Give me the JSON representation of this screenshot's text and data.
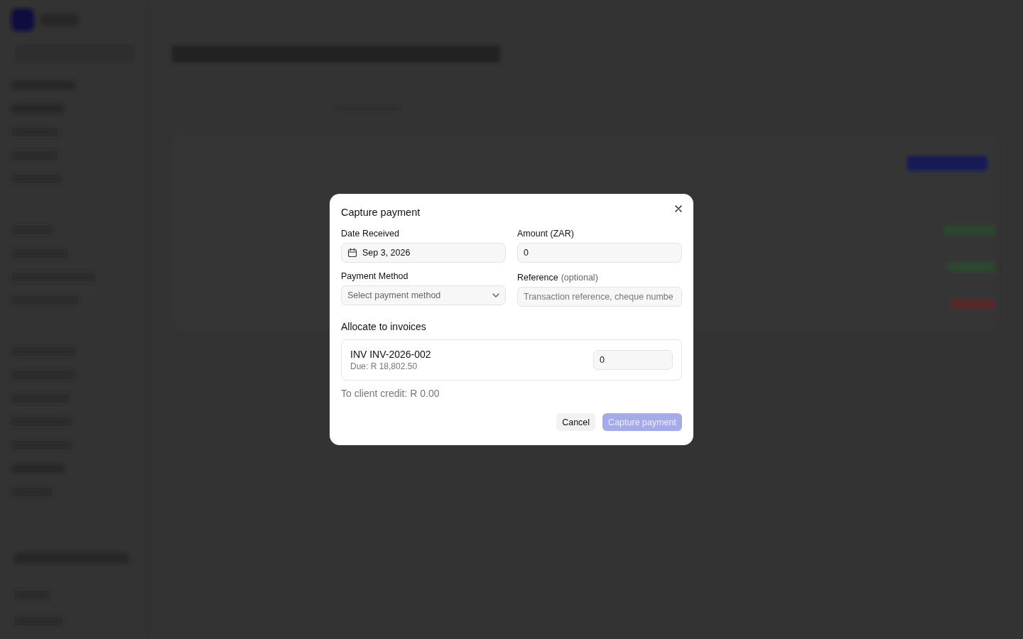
{
  "dialog": {
    "title": "Capture payment",
    "fields": [
      {
        "kind": "date",
        "label": "Date Received",
        "value": "Sep 3, 2026"
      },
      {
        "kind": "text",
        "label": "Amount (ZAR)",
        "value": "0"
      },
      {
        "kind": "select",
        "label": "Payment Method",
        "placeholder": "Select payment method"
      },
      {
        "kind": "text",
        "label": "Reference",
        "hint": "(optional)",
        "placeholder": "Transaction reference, cheque numbe"
      }
    ],
    "allocation": {
      "heading": "Allocate to invoices",
      "invoices": [
        {
          "number": "INV INV-2026-002",
          "due": "Due: R 18,802.50",
          "amount": "0"
        }
      ],
      "credit": "To client credit: R 0.00"
    },
    "buttons": [
      {
        "label": "Cancel",
        "kind": "secondary",
        "disabled": false
      },
      {
        "label": "Capture payment",
        "kind": "primary",
        "disabled": true
      }
    ]
  }
}
